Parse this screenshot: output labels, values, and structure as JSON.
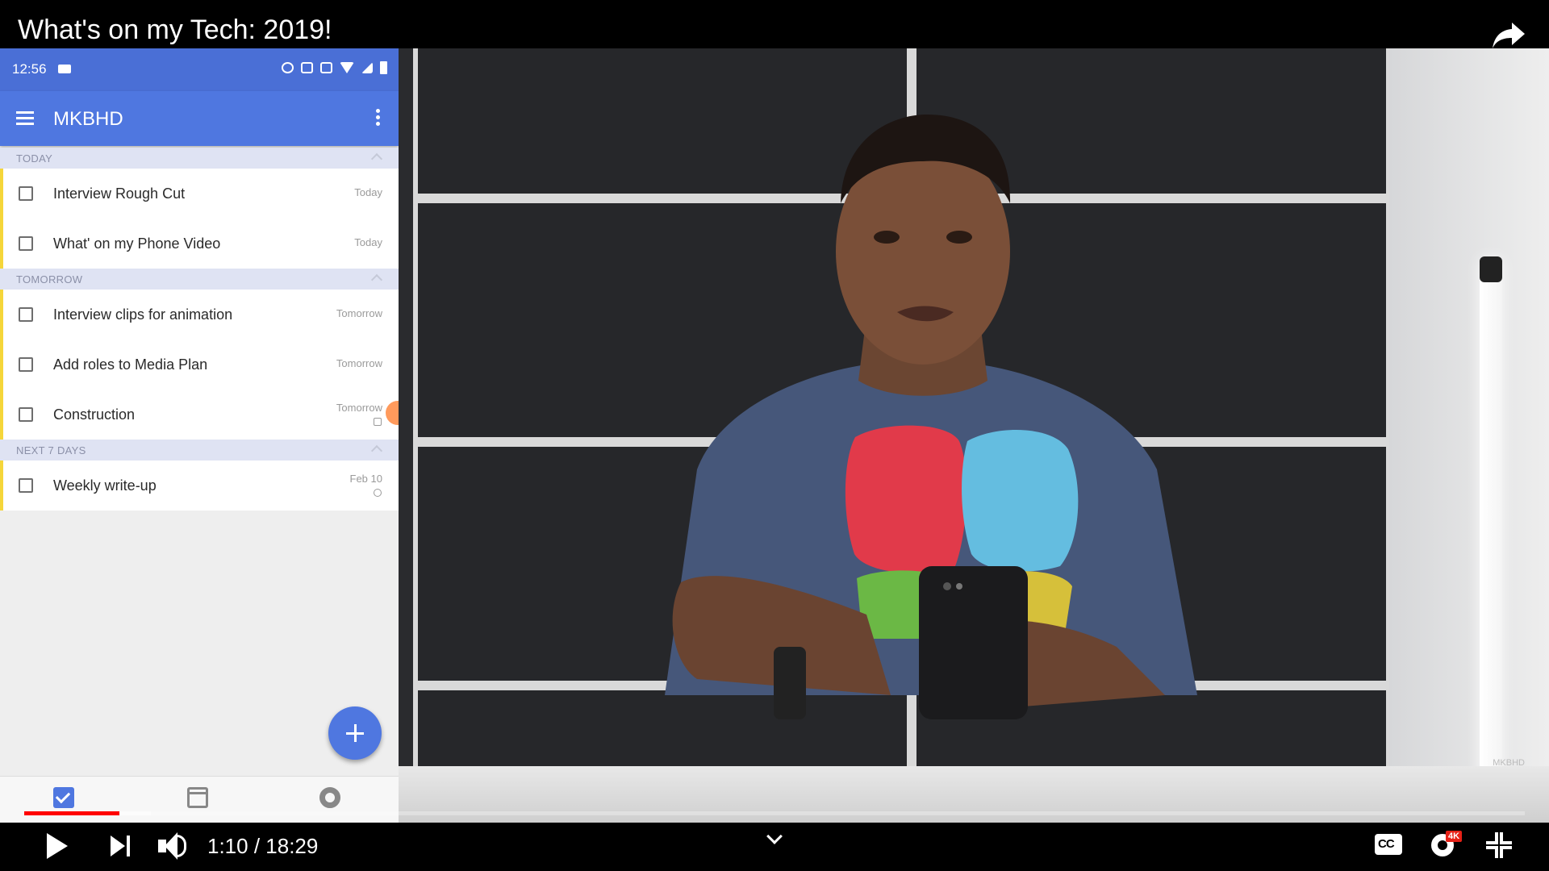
{
  "video": {
    "title": "What's on my Tech: 2019!",
    "watermark": "MKBHD"
  },
  "phone": {
    "status_time": "12:56",
    "app_title": "MKBHD",
    "sections": [
      {
        "label": "TODAY",
        "tasks": [
          {
            "label": "Interview Rough Cut",
            "date": "Today"
          },
          {
            "label": "What' on my Phone Video",
            "date": "Today"
          }
        ]
      },
      {
        "label": "TOMORROW",
        "tasks": [
          {
            "label": "Interview clips for animation",
            "date": "Tomorrow"
          },
          {
            "label": "Add roles to Media Plan",
            "date": "Tomorrow"
          },
          {
            "label": "Construction",
            "date": "Tomorrow"
          }
        ]
      },
      {
        "label": "NEXT 7 DAYS",
        "tasks": [
          {
            "label": "Weekly write-up",
            "date": "Feb 10"
          }
        ]
      }
    ],
    "accent_color": "#4f77e0",
    "task_stripe_color": "#f5d63a"
  },
  "player": {
    "time": "1:10 / 18:29",
    "progress_played": 0.063,
    "progress_color": "#ff0000",
    "quality_badge": "4K",
    "cc_label": "CC"
  }
}
